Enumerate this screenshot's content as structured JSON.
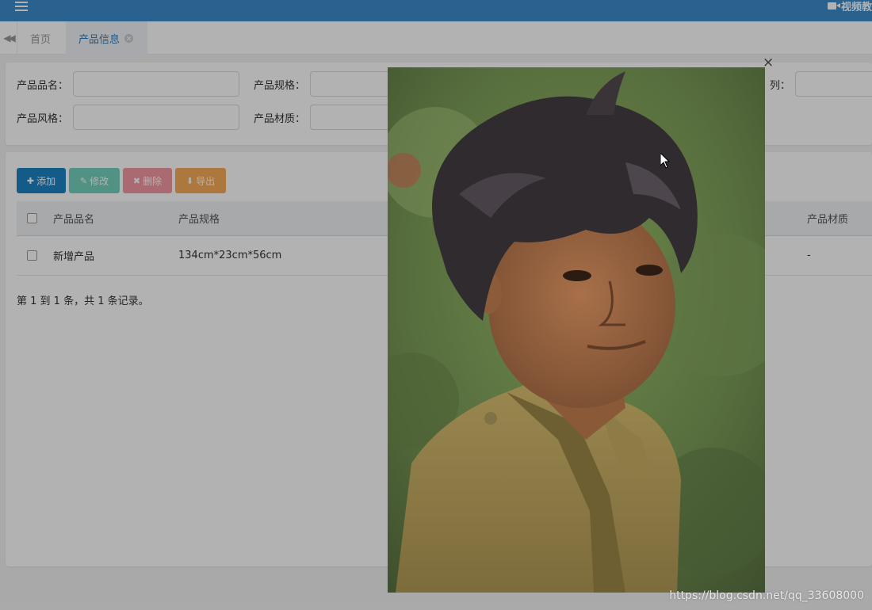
{
  "topbar": {
    "right_label": "视频教",
    "accent": "#3c8dcc"
  },
  "tabs": [
    {
      "label": "首页"
    },
    {
      "label": "产品信息"
    }
  ],
  "search": {
    "fields": [
      {
        "label": "产品品名："
      },
      {
        "label": "产品规格："
      },
      {
        "label": "列："
      },
      {
        "label": "产品风格："
      },
      {
        "label": "产品材质："
      }
    ]
  },
  "toolbar": {
    "add_label": "添加",
    "edit_label": "修改",
    "delete_label": "删除",
    "export_label": "导出"
  },
  "table": {
    "columns": [
      "产品品名",
      "产品规格",
      "产品材质"
    ],
    "rows": [
      {
        "name": "新增产品",
        "spec": "134cm*23cm*56cm",
        "material": "-"
      }
    ],
    "pager": "第 1 到 1 条，共 1 条记录。"
  },
  "modal": {
    "close_glyph": "×"
  },
  "watermark": "https://blog.csdn.net/qq_33608000"
}
